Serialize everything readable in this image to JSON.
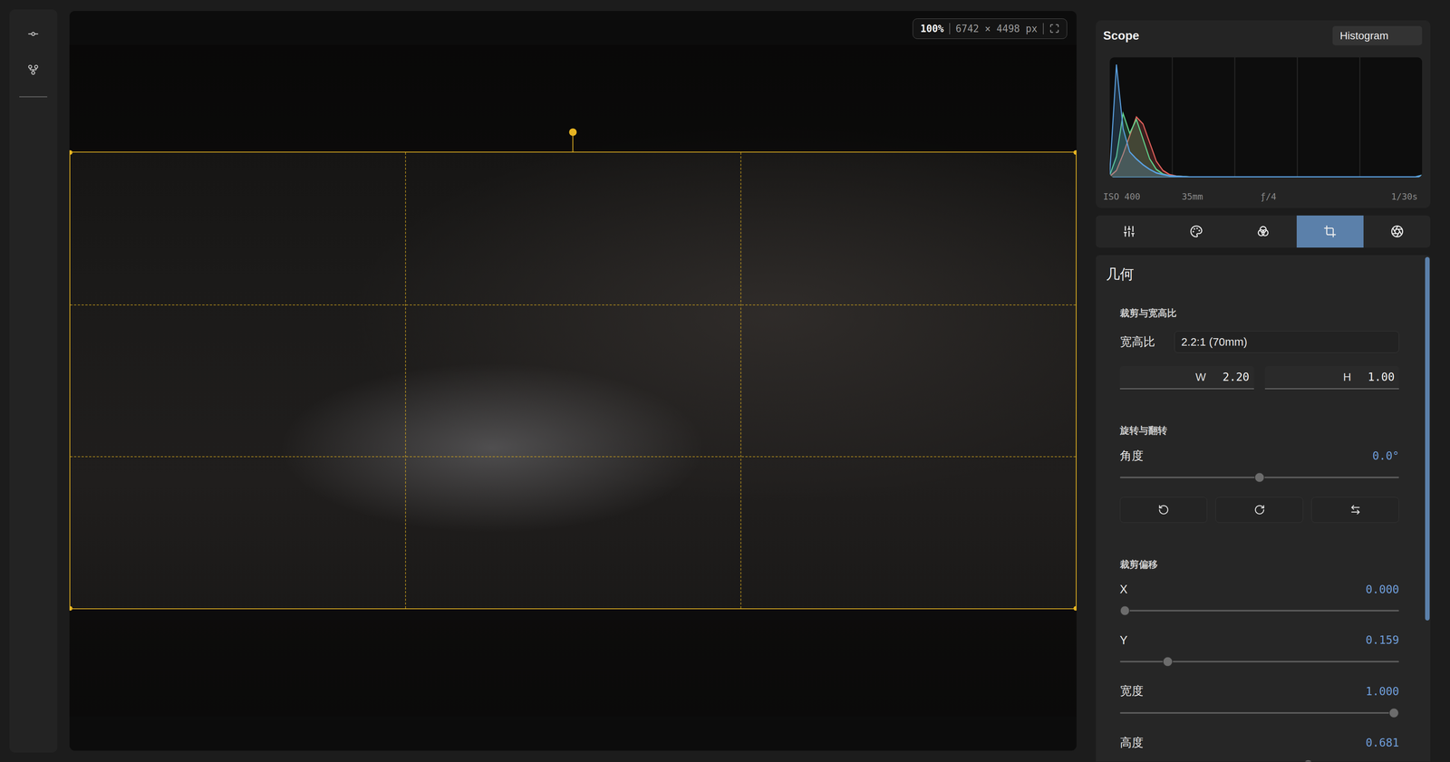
{
  "canvas": {
    "zoom": "100%",
    "dimensions": "6742 × 4498 px"
  },
  "scope": {
    "title": "Scope",
    "mode": "Histogram",
    "histogram": {
      "series": [
        {
          "color": "#e0605a",
          "values": [
            0.01,
            0.06,
            0.2,
            0.36,
            0.52,
            0.46,
            0.3,
            0.14,
            0.06,
            0.025,
            0.012,
            0.008,
            0.004,
            0.004,
            0.004,
            0.004,
            0.004,
            0.004,
            0.004,
            0.004,
            0.004,
            0.004,
            0.004,
            0.004,
            0.004,
            0.004,
            0.004,
            0.004,
            0.004,
            0.004,
            0.004,
            0.004,
            0.004,
            0.004,
            0.004,
            0.004,
            0.004,
            0.004,
            0.004,
            0.004,
            0.004,
            0.004,
            0.004,
            0.004,
            0.004,
            0.004,
            0.004,
            0.015
          ]
        },
        {
          "color": "#5fd08a",
          "values": [
            0.02,
            0.18,
            0.55,
            0.38,
            0.5,
            0.33,
            0.16,
            0.07,
            0.03,
            0.015,
            0.01,
            0.008,
            0.005,
            0.005,
            0.005,
            0.005,
            0.005,
            0.005,
            0.005,
            0.005,
            0.005,
            0.005,
            0.005,
            0.005,
            0.005,
            0.005,
            0.005,
            0.005,
            0.005,
            0.005,
            0.005,
            0.005,
            0.005,
            0.005,
            0.005,
            0.005,
            0.005,
            0.005,
            0.005,
            0.005,
            0.005,
            0.005,
            0.005,
            0.005,
            0.005,
            0.005,
            0.005,
            0.02
          ]
        },
        {
          "color": "#5aa0e0",
          "values": [
            0.04,
            0.97,
            0.42,
            0.22,
            0.16,
            0.11,
            0.07,
            0.04,
            0.025,
            0.015,
            0.01,
            0.008,
            0.005,
            0.005,
            0.005,
            0.005,
            0.005,
            0.005,
            0.005,
            0.005,
            0.005,
            0.005,
            0.005,
            0.005,
            0.005,
            0.005,
            0.005,
            0.005,
            0.005,
            0.005,
            0.005,
            0.005,
            0.005,
            0.005,
            0.005,
            0.005,
            0.005,
            0.005,
            0.005,
            0.005,
            0.005,
            0.005,
            0.005,
            0.005,
            0.005,
            0.005,
            0.005,
            0.02
          ]
        }
      ]
    },
    "exif": [
      "ISO 400",
      "35mm",
      "ƒ/4",
      "1/30s"
    ]
  },
  "tool_tabs": [
    {
      "selected": false
    },
    {
      "selected": false
    },
    {
      "selected": false
    },
    {
      "selected": true
    },
    {
      "selected": false
    }
  ],
  "panel": {
    "title": "几何",
    "sections": [
      {
        "title": "裁剪与宽高比",
        "rows": [
          {
            "kind": "select",
            "label": "宽高比",
            "value": "2.2:1 (70mm)"
          },
          {
            "kind": "pair",
            "fields": [
              {
                "label": "W",
                "value": "2.20"
              },
              {
                "label": "H",
                "value": "1.00"
              }
            ]
          }
        ]
      },
      {
        "title": "旋转与翻转",
        "rows": [
          {
            "kind": "slider",
            "label": "角度",
            "value": "0.0°",
            "level": 0.5
          },
          {
            "kind": "buttons"
          }
        ]
      },
      {
        "title": "裁剪偏移",
        "rows": [
          {
            "kind": "slider",
            "label": "X",
            "value": "0.000",
            "level": 0
          },
          {
            "kind": "slider",
            "label": "Y",
            "value": "0.159",
            "level": 0.159
          },
          {
            "kind": "slider",
            "label": "宽度",
            "value": "1.000",
            "level": 1
          },
          {
            "kind": "slider",
            "label": "高度",
            "value": "0.681",
            "level": 0.681
          }
        ]
      }
    ]
  },
  "scrollbar": {
    "level": 0.72
  }
}
